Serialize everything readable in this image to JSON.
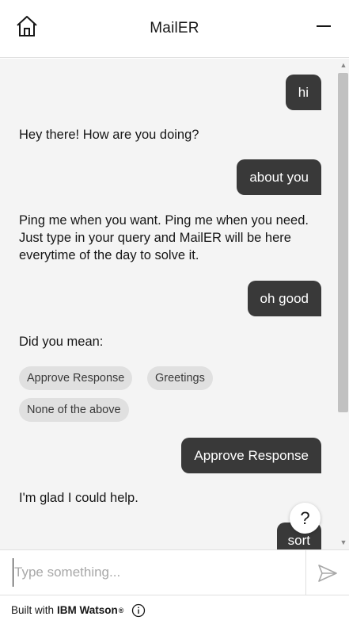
{
  "header": {
    "title": "MailER",
    "home_icon": "home-icon",
    "minimize_icon": "minimize-icon"
  },
  "conversation": {
    "user_messages": [
      "hi",
      "about you",
      "oh good",
      "Approve Response",
      "sort"
    ],
    "bot_messages": [
      "Hey there! How are you doing?",
      "Ping me when you want. Ping me when you need. Just type in your query and MailER will be here everytime of the day to solve it.",
      "Did you mean:",
      "I'm glad I could help."
    ],
    "suggestions": [
      "Approve Response",
      "Greetings",
      "None of the above"
    ]
  },
  "help_button": {
    "label": "?"
  },
  "input": {
    "placeholder": "Type something...",
    "value": ""
  },
  "footer": {
    "built_with": "Built with",
    "brand": "IBM Watson",
    "registered_mark": "®"
  },
  "colors": {
    "user_bubble": "#393939",
    "chat_background": "#f4f4f4",
    "chip_background": "#e0e0e0",
    "scrollbar_thumb": "#c1c1c1"
  }
}
